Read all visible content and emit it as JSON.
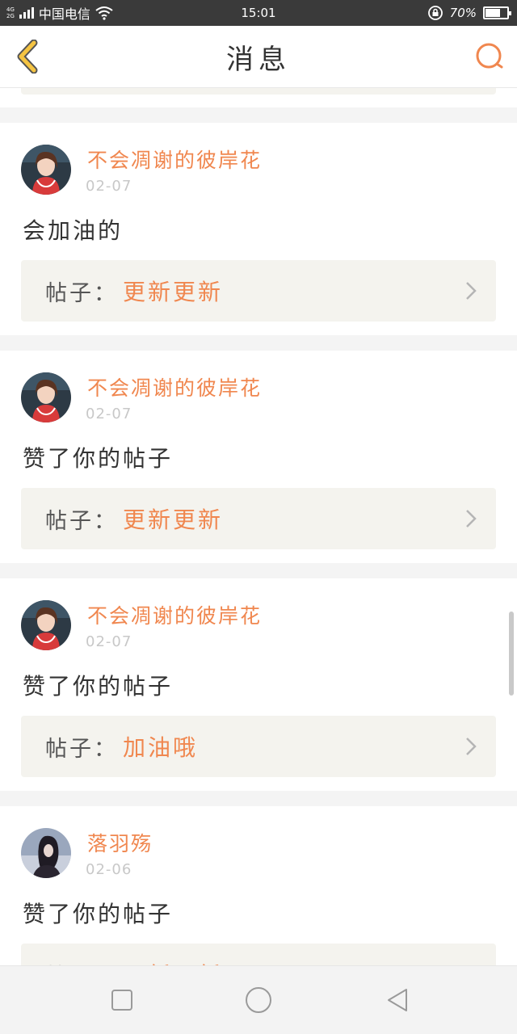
{
  "status_bar": {
    "network_top": "4G",
    "network_bottom": "2G",
    "carrier": "中国电信",
    "time": "15:01",
    "battery": "70%",
    "battery_level": 0.7
  },
  "header": {
    "title": "消息"
  },
  "post_label": "帖子：",
  "cards": [
    {
      "user": "不会凋谢的彼岸花",
      "date": "02-07",
      "message": "会加油的",
      "post_title": "更新更新"
    },
    {
      "user": "不会凋谢的彼岸花",
      "date": "02-07",
      "message": "赞了你的帖子",
      "post_title": "更新更新"
    },
    {
      "user": "不会凋谢的彼岸花",
      "date": "02-07",
      "message": "赞了你的帖子",
      "post_title": "加油哦"
    },
    {
      "user": "落羽殇",
      "date": "02-06",
      "message": "赞了你的帖子",
      "post_title": "更新更新"
    }
  ],
  "icons": {
    "back": "chevron-left-icon",
    "search": "search-icon",
    "nav_recent": "square-icon",
    "nav_home": "circle-icon",
    "nav_back": "triangle-back-icon"
  },
  "colors": {
    "accent": "#f0874f",
    "back_arrow": "#f5c442",
    "post_bg": "#f4f3ee"
  }
}
